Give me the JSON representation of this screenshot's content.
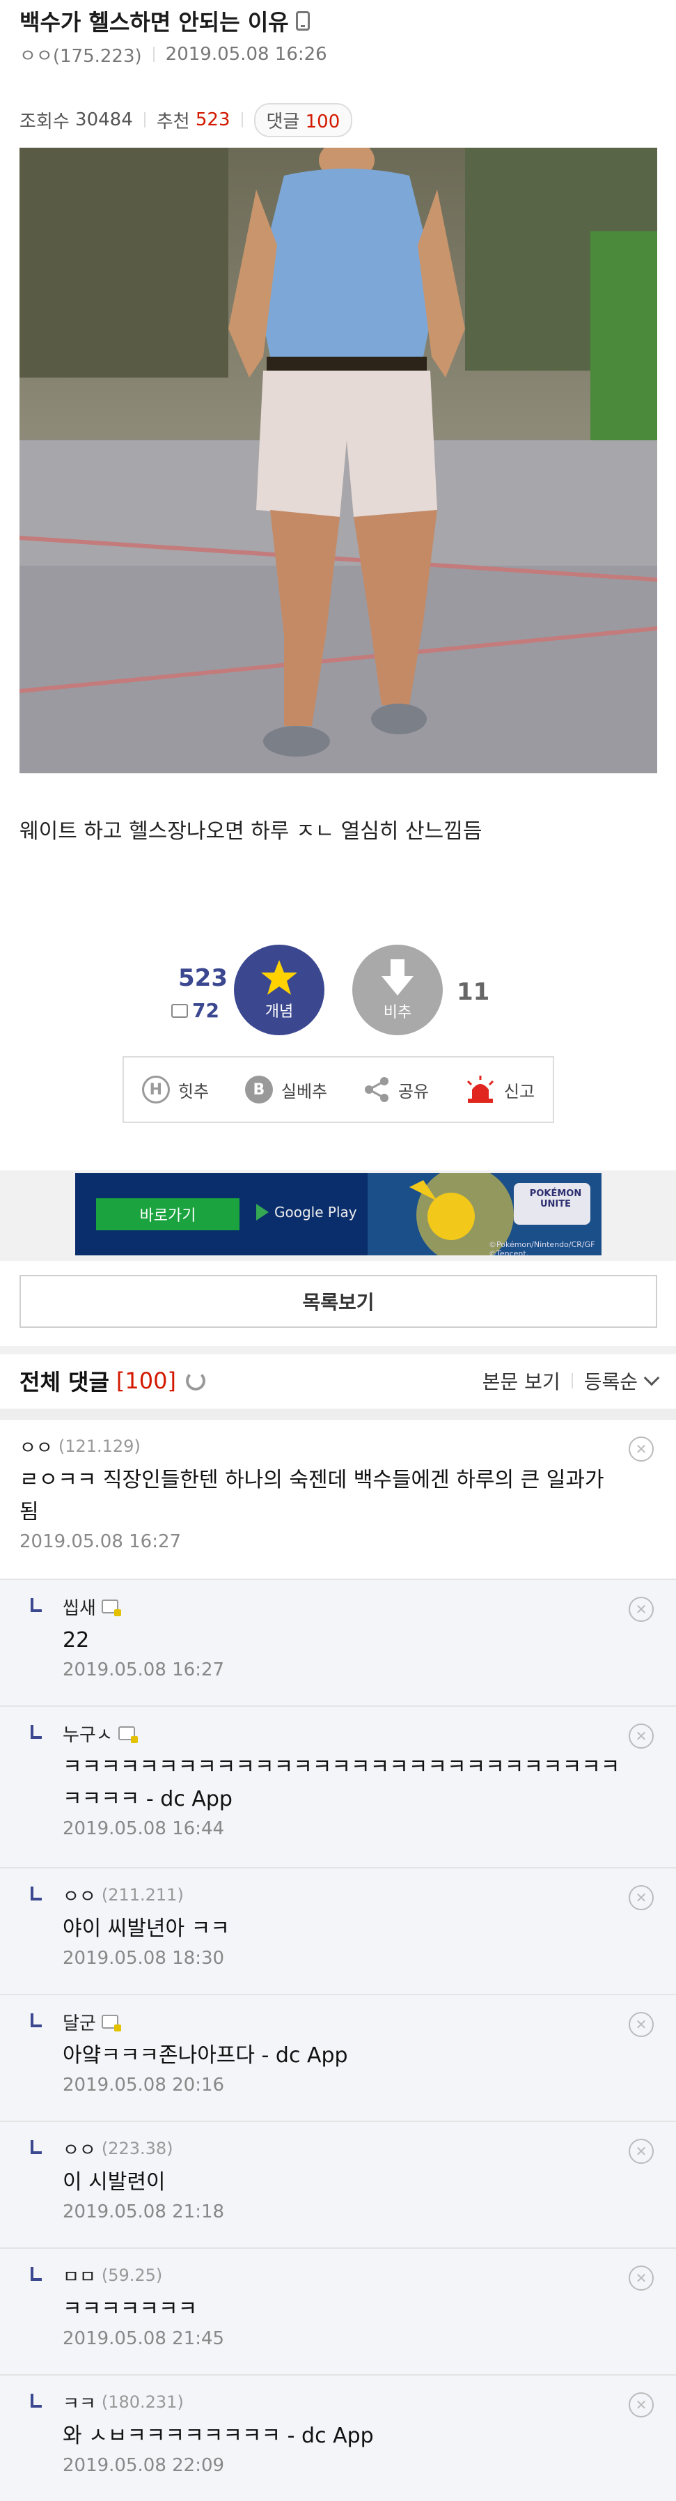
{
  "post": {
    "title": "백수가 헬스하면 안되는 이유",
    "author": "ㅇㅇ(175.223)",
    "datetime": "2019.05.08 16:26",
    "views_label": "조회수",
    "views": "30484",
    "recommend_label": "추천",
    "recommend": "523",
    "comments_label": "댓글",
    "comments": "100",
    "body": "웨이트 하고 헬스장나오면 하루 ㅈㄴ 열심히 산느낌듬"
  },
  "vote": {
    "up_count": "523",
    "up_sub": "72",
    "up_label": "개념",
    "down_label": "비추",
    "down_count": "11"
  },
  "actions": [
    {
      "label": "힛추",
      "icon": "H"
    },
    {
      "label": "실베추",
      "icon": "B"
    },
    {
      "label": "공유",
      "icon": "share-icon"
    },
    {
      "label": "신고",
      "icon": "siren-icon"
    }
  ],
  "ad": {
    "button": "바로가기",
    "store": "Google Play",
    "brand": "POKÉMON UNITE",
    "copyright": "©Pokémon/Nintendo/CR/GF ©Tencent."
  },
  "list_button": "목록보기",
  "comments_section": {
    "title": "전체 댓글",
    "count": "[100]",
    "view_body": "본문 보기",
    "sort": "등록순"
  },
  "comments": [
    {
      "name": "ㅇㅇ",
      "ip": "(121.129)",
      "text": "ㄹㅇㅋㅋ 직장인들한텐 하나의 숙젠데 백수들에겐 하루의 큰 일과가 됨",
      "date": "2019.05.08 16:27"
    },
    {
      "name": "씹새",
      "ip": "",
      "text": "22",
      "date": "2019.05.08 16:27"
    },
    {
      "name": "누구ㅅ",
      "ip": "",
      "text": "ㅋㅋㅋㅋㅋㅋㅋㅋㅋㅋㅋㅋㅋㅋㅋㅋㅋㅋㅋㅋㅋㅋㅋㅋㅋㅋㅋㅋㅋㅋㅋㅋㅋ - dc App",
      "date": "2019.05.08 16:44"
    },
    {
      "name": "ㅇㅇ",
      "ip": "(211.211)",
      "text": "야이 씨발년아 ㅋㅋ",
      "date": "2019.05.08 18:30"
    },
    {
      "name": "달군",
      "ip": "",
      "text": "아얔ㅋㅋㅋ존나아프다 - dc App",
      "date": "2019.05.08 20:16"
    },
    {
      "name": "ㅇㅇ",
      "ip": "(223.38)",
      "text": "이 시발련이",
      "date": "2019.05.08 21:18"
    },
    {
      "name": "ㅁㅁ",
      "ip": "(59.25)",
      "text": "ㅋㅋㅋㅋㅋㅋㅋ",
      "date": "2019.05.08 21:45"
    },
    {
      "name": "ㅋㅋ",
      "ip": "(180.231)",
      "text": "와 ㅅㅂㅋㅋㅋㅋㅋㅋㅋㅋ - dc App",
      "date": "2019.05.08 22:09"
    }
  ],
  "colors": {
    "accent_blue": "#3b4890",
    "accent_red": "#d31900",
    "reply_bg": "#f3f5f9"
  }
}
